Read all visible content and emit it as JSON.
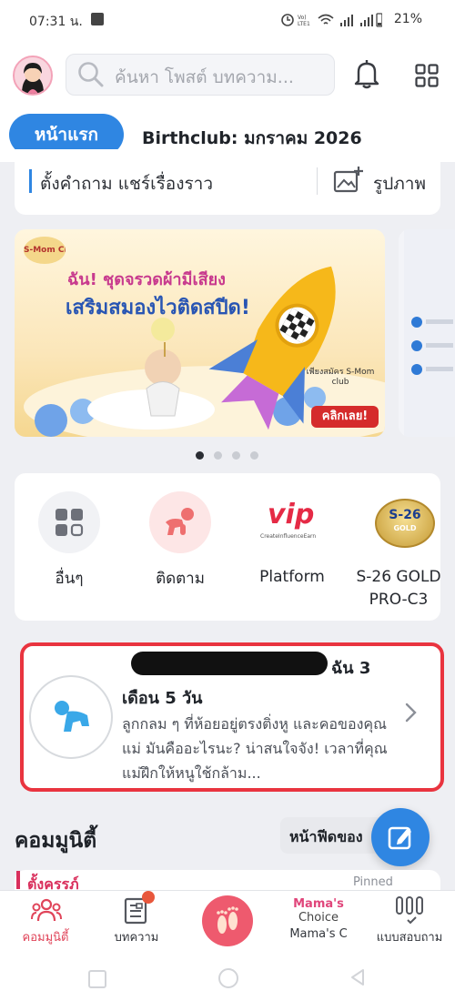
{
  "status_bar": {
    "time": "07:31 น.",
    "battery": "21%"
  },
  "header": {
    "search_placeholder": "ค้นหา โพสต์ บทความ...",
    "home_tab": "หน้าแรก",
    "club_title": "Birthclub: มกราคม 2026"
  },
  "post_bar": {
    "ask_label": "ตั้งคำถาม แชร์เรื่องราว",
    "photo_label": "รูปภาพ"
  },
  "banner": {
    "headline_1": "ฉัน! ชุดจรวดผ้ามีเสียง",
    "headline_2": "เสริมสมองไวติดสปีด!",
    "brand": "S-Mom Club",
    "cta_small": "เพียงสมัคร S-Mom club",
    "cta": "คลิกเลย!",
    "dots_total": 4,
    "dots_active": 0
  },
  "shortcuts": [
    {
      "label": "อื่นๆ",
      "icon": "grid-icon"
    },
    {
      "label": "ติดตาม",
      "icon": "baby-crawl-icon"
    },
    {
      "label": "Platform",
      "icon": "vip-logo",
      "logo_text": "vip",
      "logo_sub": "CreateInfluenceEarn"
    },
    {
      "label": "S-26 GOLD PRO-C3",
      "icon": "s26-logo",
      "logo_text": "S-26",
      "logo_sub": "GOLD"
    }
  ],
  "growth_card": {
    "title_suffix": "ฉัน 3",
    "title_line2": "เดือน 5  วัน",
    "description": "ลูกกลม ๆ ที่ห้อยอยู่ตรงติ่งหู และคอของคุณแม่ มันคืออะไรนะ? น่าสนใจจัง! เวลาที่คุณแม่ฝึกให้หนูใช้กล้าม..."
  },
  "community": {
    "title": "คอมมูนิตี้",
    "feed_button": "หน้าฟีดของ",
    "peek_title": "ตั้งครรภ์",
    "peek_badge": "Pinned"
  },
  "bottom_nav": {
    "items": [
      {
        "label": "คอมมูนิตี้",
        "icon": "community-icon",
        "active": true
      },
      {
        "label": "บทความ",
        "icon": "article-icon",
        "active": false,
        "badge": true
      },
      {
        "label": "",
        "icon": "baby-feet-icon",
        "active": false
      },
      {
        "label": "Mama's C",
        "icon": "mamas-choice-logo",
        "logo_text_1": "Mama's",
        "logo_text_2": "Choice",
        "active": false
      },
      {
        "label": "แบบสอบถาม",
        "icon": "survey-icon",
        "active": false
      }
    ]
  },
  "colors": {
    "accent_blue": "#2f86e2",
    "highlight_red": "#e9343f",
    "nav_active": "#e0455a"
  }
}
